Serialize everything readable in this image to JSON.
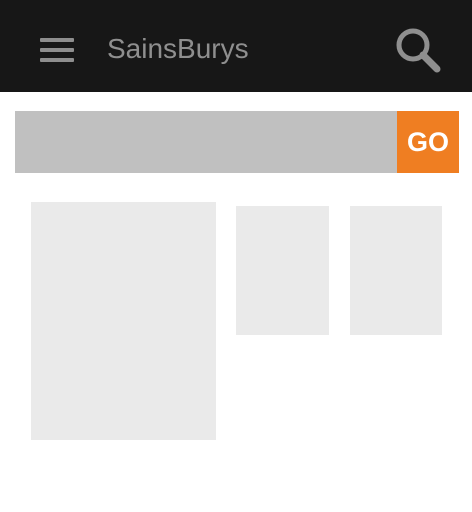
{
  "app_bar": {
    "title": "SainsBurys",
    "menu_icon": "hamburger-menu-icon",
    "search_icon": "magnifier-search-icon",
    "background_color": "#171717",
    "text_color": "#8f8f8f"
  },
  "search": {
    "value": "",
    "placeholder": "",
    "go_label": "GO",
    "go_color": "#ef7e22",
    "input_color": "#c0c0c0"
  },
  "content": {
    "tiles": [
      {
        "id": "tile-1"
      },
      {
        "id": "tile-2"
      },
      {
        "id": "tile-3"
      }
    ],
    "placeholder_color": "#eaeaea"
  }
}
